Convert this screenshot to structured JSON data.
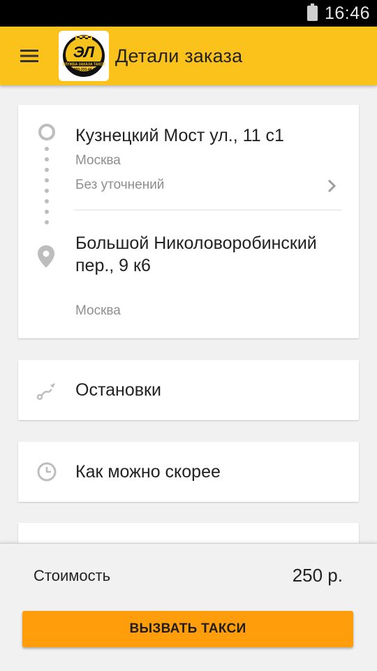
{
  "statusbar": {
    "time": "16:46",
    "battery_icon": "battery-icon"
  },
  "appbar": {
    "title": "Детали заказа",
    "menu_icon": "menu-icon",
    "logo": {
      "main": "ЭЛ",
      "line1": "СЛУЖБА ЗАКАЗА ТАКСИ",
      "line2": "8-800-333-44-43"
    }
  },
  "route": {
    "from": {
      "address": "Кузнецкий Мост ул., 11 с1",
      "city": "Москва",
      "note": "Без уточнений"
    },
    "to": {
      "address": "Большой Николоворобинский пер., 9 к6",
      "city": "Москва"
    }
  },
  "options": {
    "stops_label": "Остановки",
    "time_label": "Как можно скорее"
  },
  "footer": {
    "cost_label": "Стоимость",
    "cost_value": "250 р.",
    "call_button": "ВЫЗВАТЬ ТАКСИ"
  },
  "colors": {
    "accent": "#fbc21b",
    "button": "#ff9d0a"
  }
}
